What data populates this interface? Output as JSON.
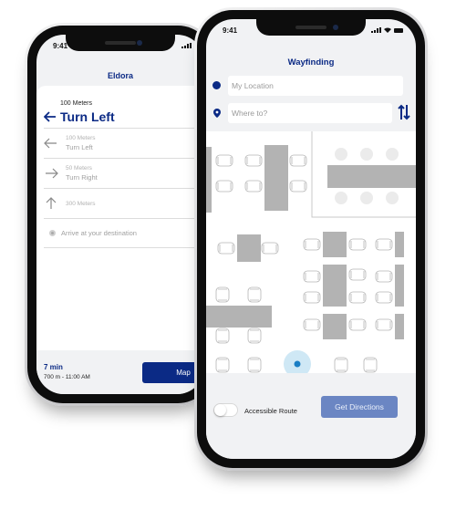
{
  "left_phone": {
    "status_time": "9:41",
    "title": "Eldora",
    "current": {
      "distance": "100 Meters",
      "instruction": "Turn Left",
      "icon": "arrow-left-icon"
    },
    "steps": [
      {
        "distance": "100 Meters",
        "instruction": "Turn Left",
        "icon": "arrow-left-icon"
      },
      {
        "distance": "50 Meters",
        "instruction": "Turn Right",
        "icon": "arrow-right-icon"
      },
      {
        "distance": "300 Meters",
        "instruction": "",
        "icon": "arrow-up-icon"
      },
      {
        "distance": "",
        "instruction": "Arrive at your destination",
        "icon": "destination-dot-icon"
      }
    ],
    "footer": {
      "eta": "7 min",
      "summary": "700 m - 11:00 AM",
      "map_button": "Map"
    }
  },
  "right_phone": {
    "status_time": "9:41",
    "title": "Wayfinding",
    "origin_placeholder": "My Location",
    "destination_placeholder": "Where to?",
    "accessible_route_label": "Accessible Route",
    "accessible_route_enabled": false,
    "get_directions_button": "Get Directions"
  },
  "colors": {
    "brand": "#0b2a85",
    "button_secondary": "#6b86c3",
    "location_marker": "#1a7ec4",
    "location_halo": "#cfe8f5",
    "furniture": "#b3b3b3",
    "background": "#f1f2f4"
  }
}
